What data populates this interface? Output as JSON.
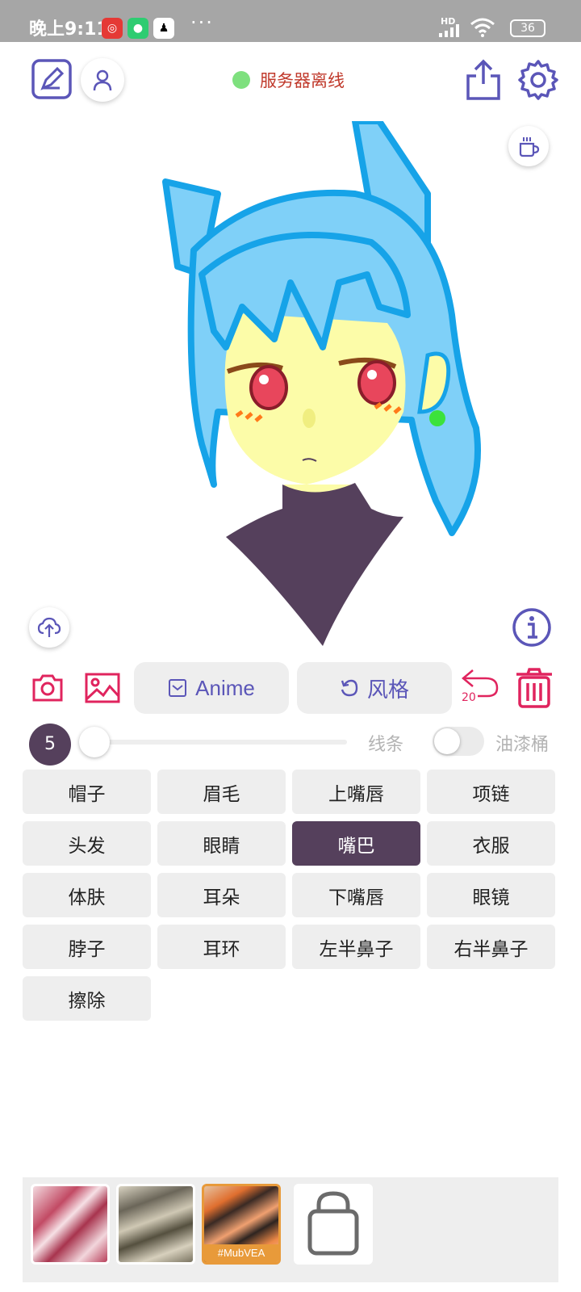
{
  "status_bar": {
    "time": "晚上9:11",
    "signal": "HD",
    "battery": "36"
  },
  "header": {
    "server_status": "服务器离线",
    "server_status_color": "#7ee07e"
  },
  "tools": {
    "anime_label": "Anime",
    "style_label": "风格",
    "undo_count": "20"
  },
  "brush": {
    "size": "5",
    "line_label": "线条",
    "bucket_label": "油漆桶",
    "bucket_enabled": false
  },
  "parts": [
    {
      "label": "帽子",
      "active": false
    },
    {
      "label": "眉毛",
      "active": false
    },
    {
      "label": "上嘴唇",
      "active": false
    },
    {
      "label": "项链",
      "active": false
    },
    {
      "label": "头发",
      "active": false
    },
    {
      "label": "眼睛",
      "active": false
    },
    {
      "label": "嘴巴",
      "active": true
    },
    {
      "label": "衣服",
      "active": false
    },
    {
      "label": "体肤",
      "active": false
    },
    {
      "label": "耳朵",
      "active": false
    },
    {
      "label": "下嘴唇",
      "active": false
    },
    {
      "label": "眼镜",
      "active": false
    },
    {
      "label": "脖子",
      "active": false
    },
    {
      "label": "耳环",
      "active": false
    },
    {
      "label": "左半鼻子",
      "active": false
    },
    {
      "label": "右半鼻子",
      "active": false
    },
    {
      "label": "擦除",
      "active": false
    }
  ],
  "textures": {
    "tag": "#MubVEA"
  },
  "colors": {
    "accent_purple": "#5b56b8",
    "accent_red": "#e0245e",
    "active_part": "#55405c"
  }
}
